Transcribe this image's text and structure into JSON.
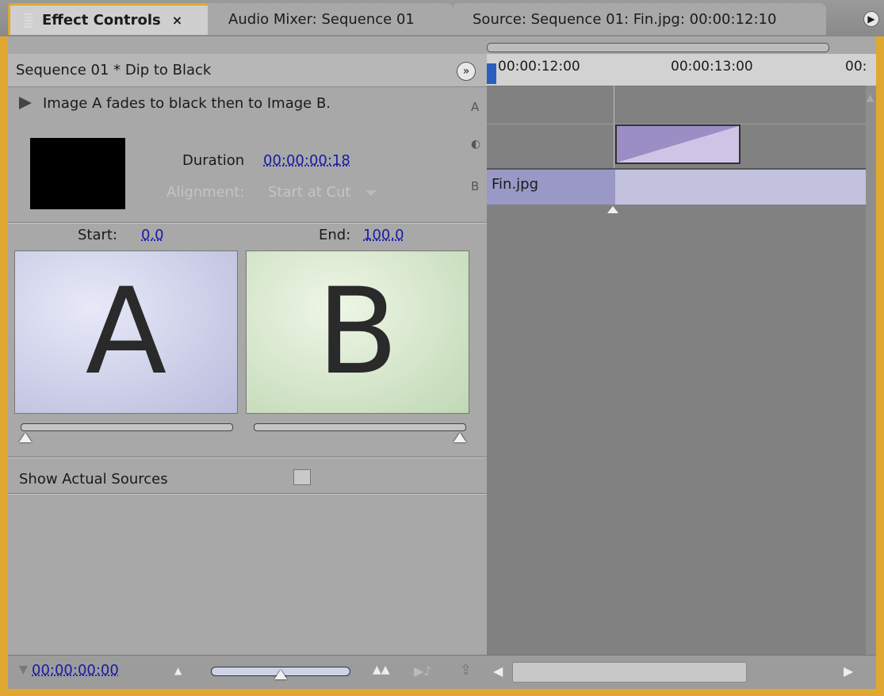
{
  "tabs": [
    {
      "label": "Effect Controls",
      "active": true,
      "close": "×"
    },
    {
      "label": "Audio Mixer: Sequence 01",
      "active": false
    },
    {
      "label": "Source: Sequence 01: Fin.jpg: 00:00:12:10",
      "active": false
    }
  ],
  "header": {
    "sequence": "Sequence 01 * Dip to Black"
  },
  "effect": {
    "description": "Image A fades to black then to Image B.",
    "duration_label": "Duration",
    "duration_value": "00:00:00:18",
    "alignment_label": "Alignment:",
    "alignment_value": "Start at Cut",
    "start_label": "Start:",
    "start_value": "0.0",
    "end_label": "End:",
    "end_value": "100.0",
    "preview_a": "A",
    "preview_b": "B",
    "track_letters": [
      "A",
      "B"
    ],
    "show_actual_sources_label": "Show Actual Sources",
    "show_actual_sources": false
  },
  "timeline": {
    "timecodes": [
      "00:00:12:00",
      "00:00:13:00",
      "00:"
    ],
    "clip_name": "Fin.jpg"
  },
  "footer": {
    "current_time": "00:00:00:00"
  },
  "colors": {
    "accent": "#e0a830",
    "link": "#1a1aa8",
    "clip": "#c2c2de",
    "transition": "#9b8ec4"
  }
}
